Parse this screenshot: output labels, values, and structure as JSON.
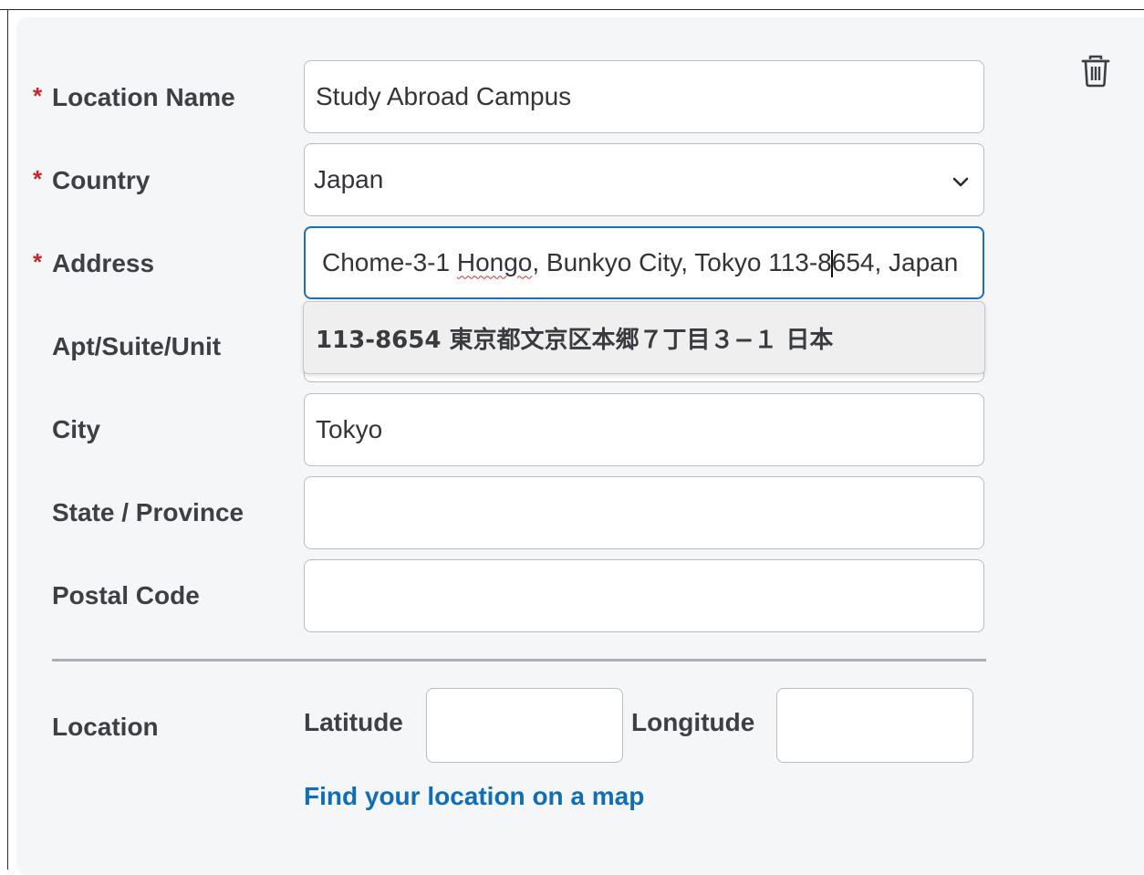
{
  "required_mark": "*",
  "form": {
    "location_name": {
      "label": "Location Name",
      "value": "Study Abroad Campus",
      "required": true
    },
    "country": {
      "label": "Country",
      "value": "Japan",
      "required": true
    },
    "address": {
      "label": "Address",
      "value_before": "Chome-3-1 ",
      "value_misspelled": "Hongo",
      "value_mid": ", Bunkyo City, Tokyo 113-8",
      "value_after": "654, Japan",
      "required": true
    },
    "address_suggestion": "113-8654 東京都文京区本郷７丁目３−１ 日本",
    "apt": {
      "label": "Apt/Suite/Unit",
      "value": ""
    },
    "city": {
      "label": "City",
      "value": "Tokyo"
    },
    "state": {
      "label": "State / Province",
      "value": ""
    },
    "postal": {
      "label": "Postal Code",
      "value": ""
    }
  },
  "location": {
    "label": "Location",
    "latitude_label": "Latitude",
    "latitude_value": "",
    "longitude_label": "Longitude",
    "longitude_value": "",
    "map_link": "Find your location on a map"
  },
  "icons": {
    "delete": "trash-icon",
    "dropdown": "chevron-down-icon"
  },
  "colors": {
    "required": "#c6262e",
    "link": "#0f6eb5",
    "focus": "#1b6fb8"
  }
}
